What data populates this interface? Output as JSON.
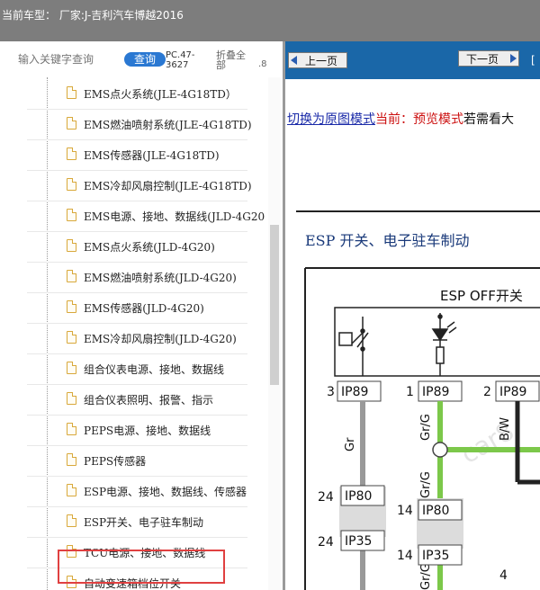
{
  "header": {
    "vehicle": "当前车型： 厂家:J-吉利汽车博越2016"
  },
  "search": {
    "placeholder": "输入关键字查询",
    "button_label": "查询",
    "code": "PC.47-3627",
    "collapse_label": "折叠全部",
    "extra": ".8"
  },
  "tree": {
    "items": [
      "EMS点火系统(JLE-4G18TD）",
      "EMS燃油喷射系统(JLE-4G18TD)",
      "EMS传感器(JLE-4G18TD)",
      "EMS冷却风扇控制(JLE-4G18TD)",
      "EMS电源、接地、数据线(JLD-4G20",
      "EMS点火系统(JLD-4G20)",
      "EMS燃油喷射系统(JLD-4G20)",
      "EMS传感器(JLD-4G20)",
      "EMS冷却风扇控制(JLD-4G20)",
      "组合仪表电源、接地、数据线",
      "组合仪表照明、报警、指示",
      "PEPS电源、接地、数据线",
      "PEPS传感器",
      "ESP电源、接地、数据线、传感器",
      "ESP开关、电子驻车制动",
      "TCU电源、接地、数据线",
      "自动变速箱档位开关"
    ],
    "selected_index": 14
  },
  "viewer": {
    "prev_label": "上一页",
    "next_label": "下一页",
    "bracket": "[",
    "switch_link": "切换为原图模式",
    "current_mode": "当前：预览模式",
    "tail_text": "若需看大",
    "page_title": "ESP 开关、电子驻车制动"
  },
  "diagram": {
    "switch_label": "ESP OFF开关",
    "connectors": [
      {
        "pin": "3",
        "name": "IP89"
      },
      {
        "pin": "1",
        "name": "IP89"
      },
      {
        "pin": "2",
        "name": "IP89"
      },
      {
        "pin": "24",
        "name": "IP80"
      },
      {
        "pin": "14",
        "name": "IP80"
      },
      {
        "pin": "24",
        "name": "IP35"
      },
      {
        "pin": "14",
        "name": "IP35"
      }
    ],
    "wire_colors": [
      "Gr",
      "Gr/G",
      "Gr/G",
      "B/W",
      "Gr/G"
    ],
    "pin_4": "4",
    "watermark": "car8"
  },
  "colors": {
    "nav_blue": "#1a67a8",
    "search_blue": "#2a78d2",
    "highlight_red": "#e04040",
    "wire_green": "#7cc84a",
    "wire_gray": "#999999"
  }
}
